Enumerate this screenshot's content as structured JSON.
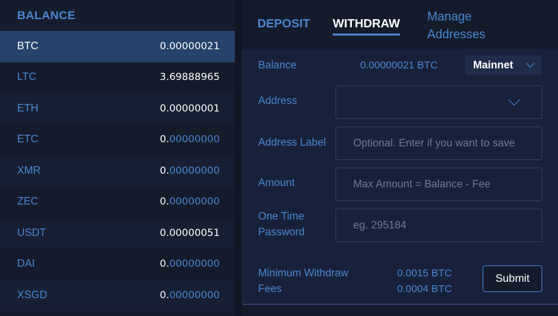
{
  "balance_panel": {
    "title": "BALANCE",
    "coins": [
      {
        "symbol": "BTC",
        "amount_lead": "0.00000021",
        "amount_tail": "",
        "active": true
      },
      {
        "symbol": "LTC",
        "amount_lead": "3.69888965",
        "amount_tail": "",
        "active": false
      },
      {
        "symbol": "ETH",
        "amount_lead": "0.00000001",
        "amount_tail": "",
        "active": false
      },
      {
        "symbol": "ETC",
        "amount_lead": "0.",
        "amount_tail": "00000000",
        "active": false
      },
      {
        "symbol": "XMR",
        "amount_lead": "0.",
        "amount_tail": "00000000",
        "active": false
      },
      {
        "symbol": "ZEC",
        "amount_lead": "0.",
        "amount_tail": "00000000",
        "active": false
      },
      {
        "symbol": "USDT",
        "amount_lead": "0.00000051",
        "amount_tail": "",
        "active": false
      },
      {
        "symbol": "DAI",
        "amount_lead": "0.",
        "amount_tail": "00000000",
        "active": false
      },
      {
        "symbol": "XSGD",
        "amount_lead": "0.",
        "amount_tail": "00000000",
        "active": false
      }
    ]
  },
  "tabs": {
    "deposit": "DEPOSIT",
    "withdraw": "WITHDRAW",
    "manage_line1": "Manage",
    "manage_line2": "Addresses",
    "active": "withdraw"
  },
  "form": {
    "balance_label": "Balance",
    "balance_value": "0.00000021 BTC",
    "network": "Mainnet",
    "address_label": "Address",
    "address_value": "",
    "address_label_label": "Address Label",
    "address_label_placeholder": "Optional. Enter if you want to save",
    "amount_label": "Amount",
    "amount_placeholder": "Max Amount = Balance - Fee",
    "otp_label_line1": "One Time",
    "otp_label_line2": "Password",
    "otp_placeholder": "eg. 295184",
    "min_withdraw_label": "Minimum Withdraw",
    "min_withdraw_value": "0.0015 BTC",
    "fees_label": "Fees",
    "fees_value": "0.0004 BTC",
    "submit_label": "Submit"
  },
  "colors": {
    "accent": "#4a86cf",
    "active_row": "#27426b",
    "background": "#141b2b"
  }
}
